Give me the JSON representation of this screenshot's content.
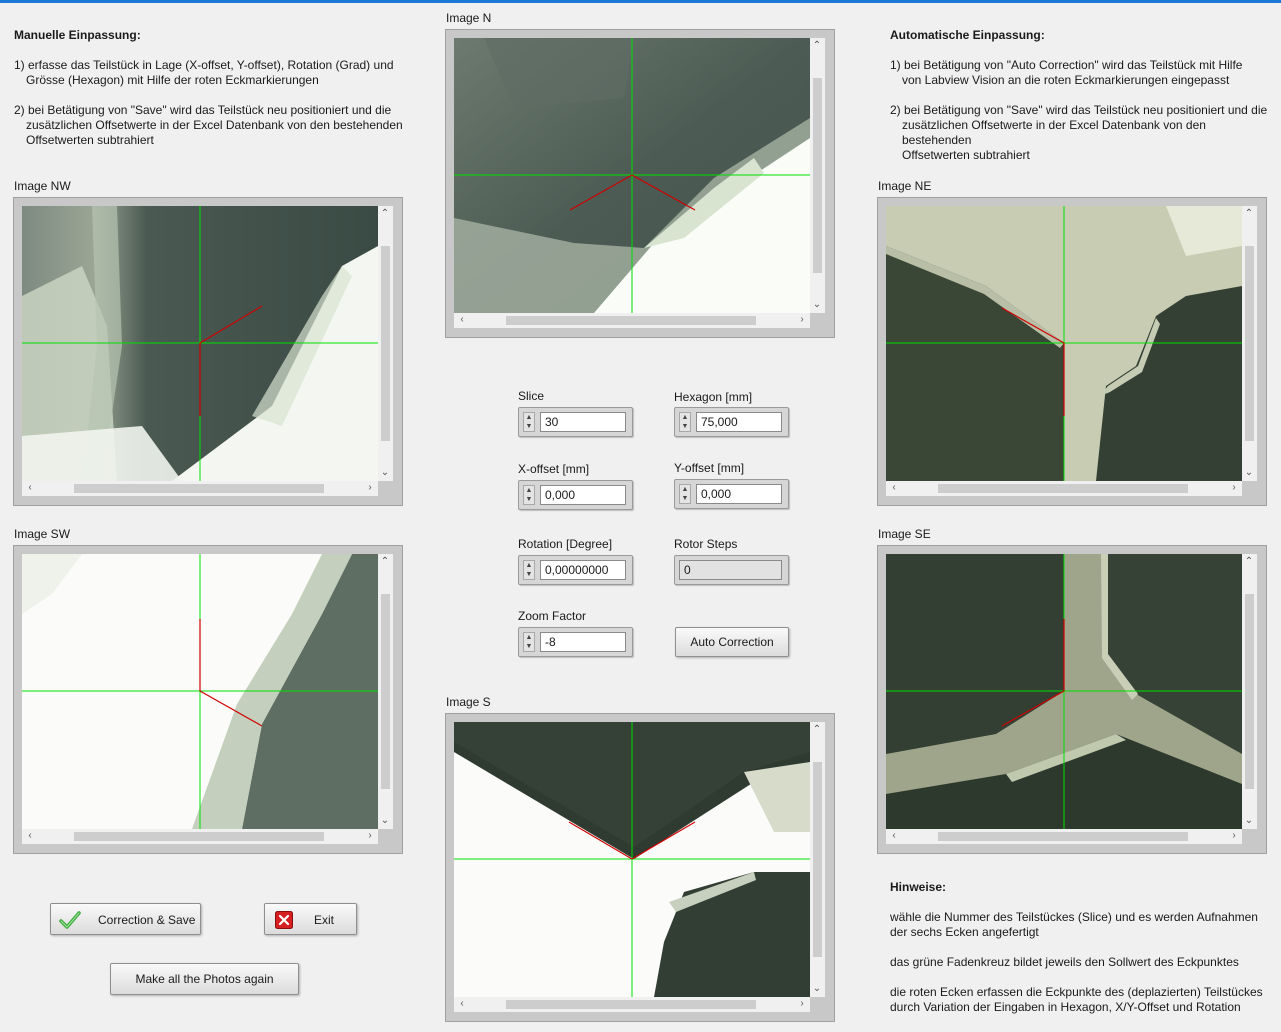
{
  "manual": {
    "title": "Manuelle Einpassung:",
    "step1_line1": "1) erfasse das Teilstück in Lage (X-offset, Y-offset), Rotation (Grad) und",
    "step1_line2": "Grösse (Hexagon) mit Hilfe der roten Eckmarkierungen",
    "step2_line1": "2) bei Betätigung von \"Save\" wird das Teilstück neu positioniert und die",
    "step2_line2": "zusätzlichen Offsetwerte in der Excel Datenbank von den bestehenden",
    "step2_line3": "Offsetwerten subtrahiert"
  },
  "auto": {
    "title": "Automatische Einpassung:",
    "step1_line1": "1) bei Betätigung von \"Auto Correction\" wird das Teilstück mit Hilfe",
    "step1_line2": "von Labview Vision an die roten Eckmarkierungen eingepasst",
    "step2_line1": "2) bei Betätigung von \"Save\" wird das Teilstück neu positioniert und die",
    "step2_line2": "zusätzlichen Offsetwerte in der Excel Datenbank von den bestehenden",
    "step2_line3": "Offsetwerten subtrahiert"
  },
  "images": {
    "nw": "Image NW",
    "sw": "Image SW",
    "n": "Image N",
    "s": "Image S",
    "ne": "Image NE",
    "se": "Image SE"
  },
  "controls": {
    "slice_label": "Slice",
    "slice_value": "30",
    "hexagon_label": "Hexagon [mm]",
    "hexagon_value": "75,000",
    "xoffset_label": "X-offset [mm]",
    "xoffset_value": "0,000",
    "yoffset_label": "Y-offset [mm]",
    "yoffset_value": "0,000",
    "rotation_label": "Rotation [Degree]",
    "rotation_value": "0,00000000",
    "rotor_label": "Rotor Steps",
    "rotor_value": "0",
    "zoom_label": "Zoom Factor",
    "zoom_value": "-8",
    "auto_correction": "Auto Correction"
  },
  "buttons": {
    "correction_save": "Correction & Save",
    "exit": "Exit",
    "make_photos": "Make all the Photos again"
  },
  "hints": {
    "title": "Hinweise:",
    "line1": "wähle die Nummer des  Teilstückes (Slice) und es werden Aufnahmen",
    "line2": "der sechs Ecken angefertigt",
    "line3": "das grüne Fadenkreuz bildet jeweils den Sollwert des Eckpunktes",
    "line4": "die roten Ecken erfassen die Eckpunkte des (deplazierten) Teilstückes",
    "line5": "durch Variation der Eingaben in Hexagon, X/Y-Offset und Rotation"
  },
  "colors": {
    "crosshair": "#00e000",
    "corner_marker": "#d00000",
    "accent": "#1c7ad6"
  }
}
